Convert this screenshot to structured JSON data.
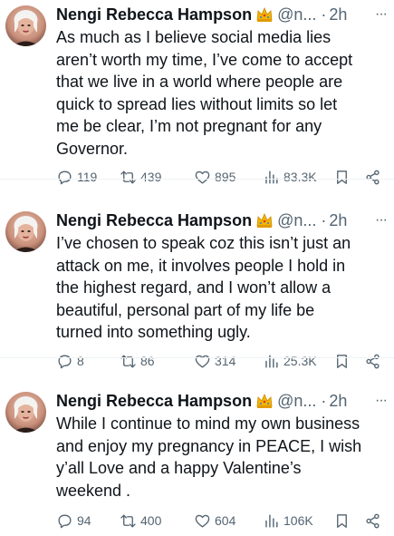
{
  "tweets": [
    {
      "name": "Nengi Rebecca Hampson",
      "handle": "@n...",
      "separator": "·",
      "time": "2h",
      "more": "···",
      "text": "As much as I believe social media lies\naren’t worth my time, I’ve come to accept\nthat we live in a world where people are\nquick to spread lies without limits so let\nme be clear, I’m not pregnant for any\nGovernor.",
      "replies": "119",
      "retweets": "439",
      "likes": "895",
      "views": "83.3K"
    },
    {
      "name": "Nengi Rebecca Hampson",
      "handle": "@n...",
      "separator": "·",
      "time": "2h",
      "more": "···",
      "text": "I’ve chosen to speak coz this isn’t just an\nattack on me, it involves people I hold in\nthe highest regard, and I won’t allow a\nbeautiful, personal part of my life be\nturned into something ugly.",
      "replies": "8",
      "retweets": "86",
      "likes": "314",
      "views": "25.3K"
    },
    {
      "name": "Nengi Rebecca Hampson",
      "handle": "@n...",
      "separator": "·",
      "time": "2h",
      "more": "···",
      "text": "While I continue to mind my own business\nand enjoy my pregnancy in PEACE, I wish\ny’all Love and a happy Valentine’s\nweekend .",
      "replies": "94",
      "retweets": "400",
      "likes": "604",
      "views": "106K"
    }
  ],
  "icons": {
    "badge": "crown-emoji-icon",
    "reply": "reply-icon",
    "retweet": "retweet-icon",
    "like": "heart-icon",
    "views": "views-icon",
    "bookmark": "bookmark-icon",
    "share": "share-icon"
  },
  "colors": {
    "text": "#0f1419",
    "secondary": "#536471",
    "background": "#ffffff"
  }
}
